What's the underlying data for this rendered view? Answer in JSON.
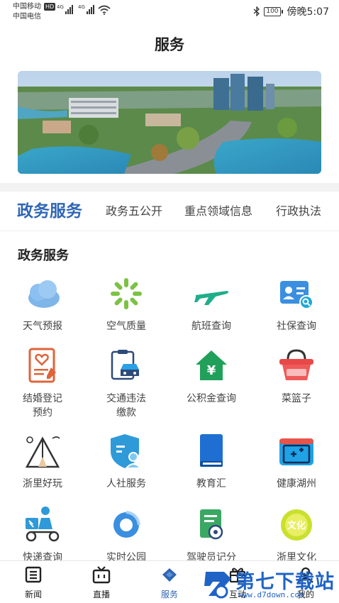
{
  "status_bar": {
    "carrier_1": "中国移动",
    "carrier_2": "中国电信",
    "hd": "HD",
    "net_1": "4G",
    "net_2": "4G",
    "battery": "100",
    "time": "傍晚5:07"
  },
  "header": {
    "title": "服务"
  },
  "banner": {
    "alt_icon": "city-aerial-photo"
  },
  "tabs": [
    {
      "label": "政务服务",
      "active": true
    },
    {
      "label": "政务五公开",
      "active": false
    },
    {
      "label": "重点领域信息",
      "active": false
    },
    {
      "label": "行政执法",
      "active": false
    }
  ],
  "section": {
    "title": "政务服务"
  },
  "services": [
    {
      "label": "天气预报",
      "icon": "cloud-icon"
    },
    {
      "label": "空气质量",
      "icon": "air-quality-icon"
    },
    {
      "label": "航班查询",
      "icon": "airplane-icon"
    },
    {
      "label": "社保查询",
      "icon": "social-security-card-icon"
    },
    {
      "label": "结婚登记\n预约",
      "icon": "marriage-form-icon"
    },
    {
      "label": "交通违法\n缴款",
      "icon": "car-clipboard-icon"
    },
    {
      "label": "公积金查询",
      "icon": "housing-fund-icon"
    },
    {
      "label": "菜篮子",
      "icon": "basket-icon"
    },
    {
      "label": "浙里好玩",
      "icon": "tent-icon"
    },
    {
      "label": "人社服务",
      "icon": "shield-person-icon"
    },
    {
      "label": "教育汇",
      "icon": "book-icon"
    },
    {
      "label": "健康湖州",
      "icon": "medical-kit-icon"
    },
    {
      "label": "快递查询",
      "icon": "delivery-scooter-icon"
    },
    {
      "label": "实时公园",
      "icon": "swirl-icon"
    },
    {
      "label": "驾驶员记分",
      "icon": "driver-score-icon"
    },
    {
      "label": "浙里文化",
      "icon": "culture-badge-icon"
    }
  ],
  "culture_badge_text": "文化",
  "bottom_nav": [
    {
      "label": "新闻",
      "icon": "news-icon",
      "active": false
    },
    {
      "label": "直播",
      "icon": "tv-icon",
      "active": false
    },
    {
      "label": "服务",
      "icon": "heart-diamond-icon",
      "active": true
    },
    {
      "label": "互动",
      "icon": "gift-icon",
      "active": false
    },
    {
      "label": "我的",
      "icon": "profile-icon",
      "active": false
    }
  ],
  "watermark": {
    "text": "第七下载站",
    "url": "www.d7down.com"
  },
  "colors": {
    "accent": "#2f66b3",
    "text": "#444444"
  }
}
